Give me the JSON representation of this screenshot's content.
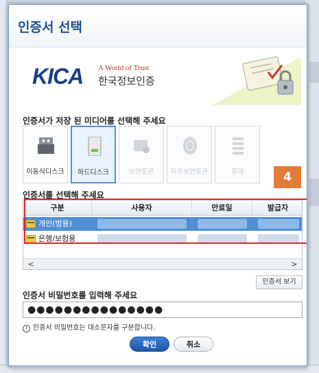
{
  "dialog": {
    "title": "인증서 선택",
    "brand": {
      "logo_text": "KICA",
      "tagline": "A World of Trust",
      "korean_name": "한국정보인증"
    }
  },
  "media_section": {
    "label": "인증서가 저장 된 미디어를 선택해 주세요",
    "items": [
      {
        "label": "이동식디스크",
        "icon": "usb-drive-icon",
        "enabled": true,
        "selected": false
      },
      {
        "label": "하드디스크",
        "icon": "hard-disk-icon",
        "enabled": true,
        "selected": true
      },
      {
        "label": "보안토큰",
        "icon": "security-token-icon",
        "enabled": false,
        "selected": false
      },
      {
        "label": "지문보안토큰",
        "icon": "fingerprint-token-icon",
        "enabled": false,
        "selected": false
      },
      {
        "label": "휴대",
        "icon": "mobile-icon",
        "enabled": false,
        "selected": false
      }
    ]
  },
  "annotation_badge": "4",
  "cert_section": {
    "label": "인증서를 선택해 주세요",
    "columns": [
      "구분",
      "사용자",
      "만료일",
      "발급자"
    ],
    "rows": [
      {
        "type": "개인(범용)",
        "selected": true
      },
      {
        "type": "은행/보험용",
        "selected": false
      }
    ],
    "scroll_left": "<",
    "scroll_right": ">",
    "view_button": "인증서 보기"
  },
  "password_section": {
    "label": "인증서 비밀번호를 입력해 주세요",
    "value": "●●●●●●●●●●●●●●●",
    "hint_icon": "!",
    "hint": "인증서 비밀번호는 대소문자를 구분합니다."
  },
  "buttons": {
    "ok": "확인",
    "cancel": "취소"
  },
  "colors": {
    "title": "#1d4f95",
    "selection": "#4f8fd6",
    "badge": "#e57b3a",
    "highlight_box": "#e02424"
  }
}
